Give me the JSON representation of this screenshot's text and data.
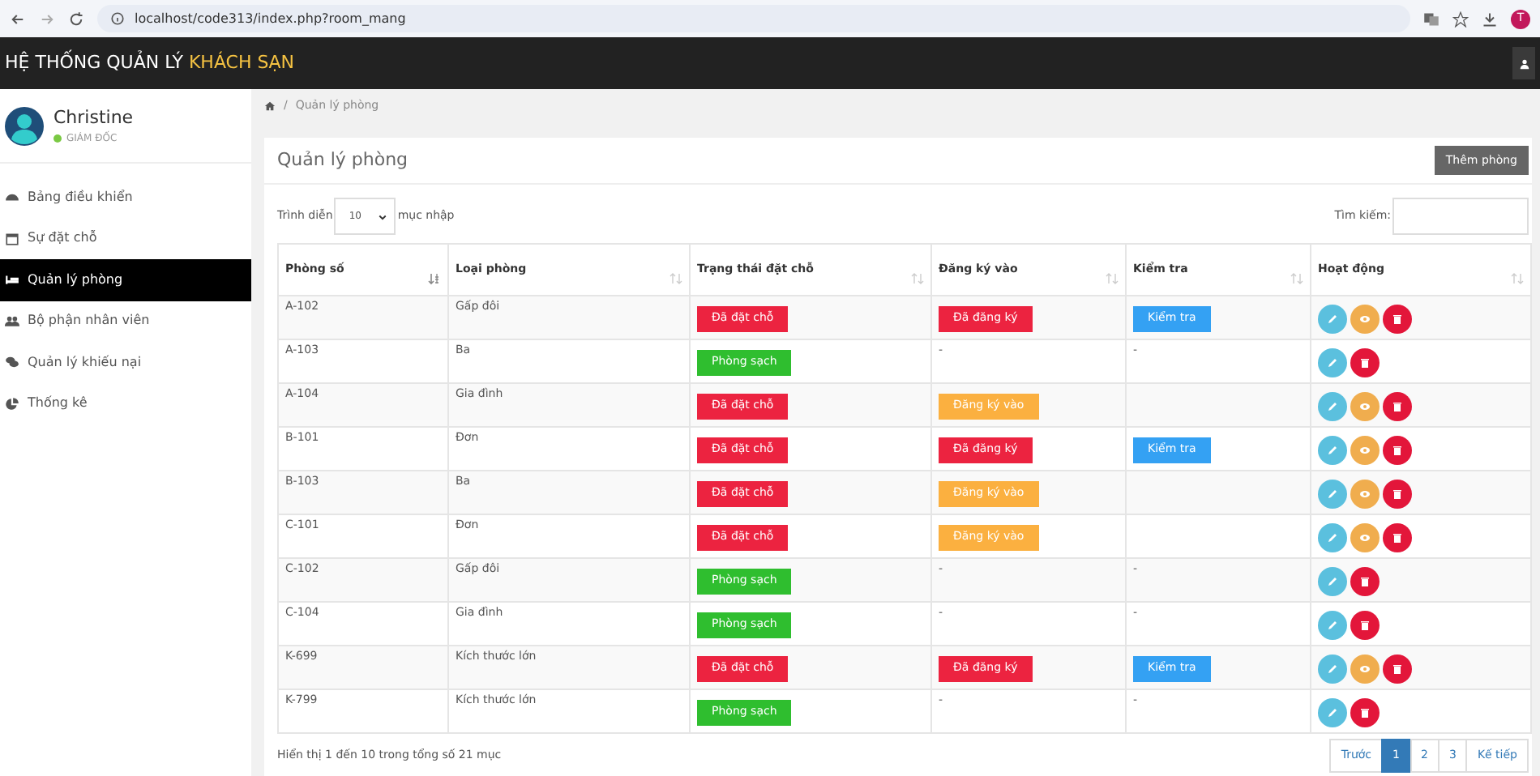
{
  "browser": {
    "url": "localhost/code313/index.php?room_mang",
    "profile": "T"
  },
  "navbar": {
    "title": "HỆ THỐNG QUẢN LÝ",
    "title_highlight": "KHÁCH SẠN"
  },
  "user": {
    "name": "Christine",
    "role": "GIÁM ĐỐC",
    "online": true
  },
  "sidebar": {
    "items": [
      {
        "label": "Bảng điều khiển",
        "selected": false
      },
      {
        "label": "Sự đặt chỗ",
        "selected": false
      },
      {
        "label": "Quản lý phòng",
        "selected": true
      },
      {
        "label": "Bộ phận nhân viên",
        "selected": false
      },
      {
        "label": "Quản lý khiếu nại",
        "selected": false
      },
      {
        "label": "Thống kê",
        "selected": false
      }
    ]
  },
  "breadcrumb": {
    "separator": "/",
    "items": [
      "Quản lý phòng"
    ]
  },
  "card": {
    "title": "Quản lý phòng",
    "add_button": "Thêm phòng"
  },
  "table_controls": {
    "show_label": "Trình diễn",
    "page_size": "10",
    "entries_label": "mục nhập",
    "search_label": "Tìm kiếm:"
  },
  "table": {
    "columns": [
      {
        "label": "Phòng số",
        "sorted": true
      },
      {
        "label": "Loại phòng",
        "sorted": false
      },
      {
        "label": "Trạng thái đặt chỗ",
        "sorted": false
      },
      {
        "label": "Đăng ký vào",
        "sorted": false
      },
      {
        "label": "Kiểm tra",
        "sorted": false
      },
      {
        "label": "Hoạt động",
        "sorted": false
      }
    ],
    "rows": [
      {
        "room": "A-102",
        "type": "Gấp đôi",
        "status": {
          "kind": "booked",
          "text": "Đã đặt chỗ"
        },
        "checkin": {
          "kind": "registered",
          "text": "Đã đăng ký"
        },
        "check": {
          "kind": "button",
          "text": "Kiểm tra"
        },
        "actions": [
          {
            "kind": "edit"
          },
          {
            "kind": "view"
          },
          {
            "kind": "delete"
          }
        ]
      },
      {
        "room": "A-103",
        "type": "Ba",
        "status": {
          "kind": "clean",
          "text": "Phòng sạch"
        },
        "checkin": {
          "kind": "dash",
          "text": "-"
        },
        "check": {
          "kind": "dash",
          "text": "-"
        },
        "actions": [
          {
            "kind": "edit"
          },
          {
            "kind": "delete"
          }
        ]
      },
      {
        "room": "A-104",
        "type": "Gia đình",
        "status": {
          "kind": "booked",
          "text": "Đã đặt chỗ"
        },
        "checkin": {
          "kind": "pending",
          "text": "Đăng ký vào"
        },
        "check": {
          "kind": "blank"
        },
        "actions": [
          {
            "kind": "edit"
          },
          {
            "kind": "view"
          },
          {
            "kind": "delete"
          }
        ]
      },
      {
        "room": "B-101",
        "type": "Đơn",
        "status": {
          "kind": "booked",
          "text": "Đã đặt chỗ"
        },
        "checkin": {
          "kind": "registered",
          "text": "Đã đăng ký"
        },
        "check": {
          "kind": "button",
          "text": "Kiểm tra"
        },
        "actions": [
          {
            "kind": "edit"
          },
          {
            "kind": "view"
          },
          {
            "kind": "delete"
          }
        ]
      },
      {
        "room": "B-103",
        "type": "Ba",
        "status": {
          "kind": "booked",
          "text": "Đã đặt chỗ"
        },
        "checkin": {
          "kind": "pending",
          "text": "Đăng ký vào"
        },
        "check": {
          "kind": "blank"
        },
        "actions": [
          {
            "kind": "edit"
          },
          {
            "kind": "view"
          },
          {
            "kind": "delete"
          }
        ]
      },
      {
        "room": "C-101",
        "type": "Đơn",
        "status": {
          "kind": "booked",
          "text": "Đã đặt chỗ"
        },
        "checkin": {
          "kind": "pending",
          "text": "Đăng ký vào"
        },
        "check": {
          "kind": "blank"
        },
        "actions": [
          {
            "kind": "edit"
          },
          {
            "kind": "view"
          },
          {
            "kind": "delete"
          }
        ]
      },
      {
        "room": "C-102",
        "type": "Gấp đôi",
        "status": {
          "kind": "clean",
          "text": "Phòng sạch"
        },
        "checkin": {
          "kind": "dash",
          "text": "-"
        },
        "check": {
          "kind": "dash",
          "text": "-"
        },
        "actions": [
          {
            "kind": "edit"
          },
          {
            "kind": "delete"
          }
        ]
      },
      {
        "room": "C-104",
        "type": "Gia đình",
        "status": {
          "kind": "clean",
          "text": "Phòng sạch"
        },
        "checkin": {
          "kind": "dash",
          "text": "-"
        },
        "check": {
          "kind": "dash",
          "text": "-"
        },
        "actions": [
          {
            "kind": "edit"
          },
          {
            "kind": "delete"
          }
        ]
      },
      {
        "room": "K-699",
        "type": "Kích thước lớn",
        "status": {
          "kind": "booked",
          "text": "Đã đặt chỗ"
        },
        "checkin": {
          "kind": "registered",
          "text": "Đã đăng ký"
        },
        "check": {
          "kind": "button",
          "text": "Kiểm tra"
        },
        "actions": [
          {
            "kind": "edit"
          },
          {
            "kind": "view"
          },
          {
            "kind": "delete"
          }
        ]
      },
      {
        "room": "K-799",
        "type": "Kích thước lớn",
        "status": {
          "kind": "clean",
          "text": "Phòng sạch"
        },
        "checkin": {
          "kind": "dash",
          "text": "-"
        },
        "check": {
          "kind": "dash",
          "text": "-"
        },
        "actions": [
          {
            "kind": "edit"
          },
          {
            "kind": "delete"
          }
        ]
      }
    ]
  },
  "footer": {
    "info": "Hiển thị 1 đến 10 trong tổng số 21 mục",
    "pagination": [
      {
        "label": "Trước",
        "selected": false
      },
      {
        "label": "1",
        "selected": true
      },
      {
        "label": "2",
        "selected": false
      },
      {
        "label": "3",
        "selected": false
      },
      {
        "label": "Kế tiếp",
        "selected": false
      }
    ]
  }
}
